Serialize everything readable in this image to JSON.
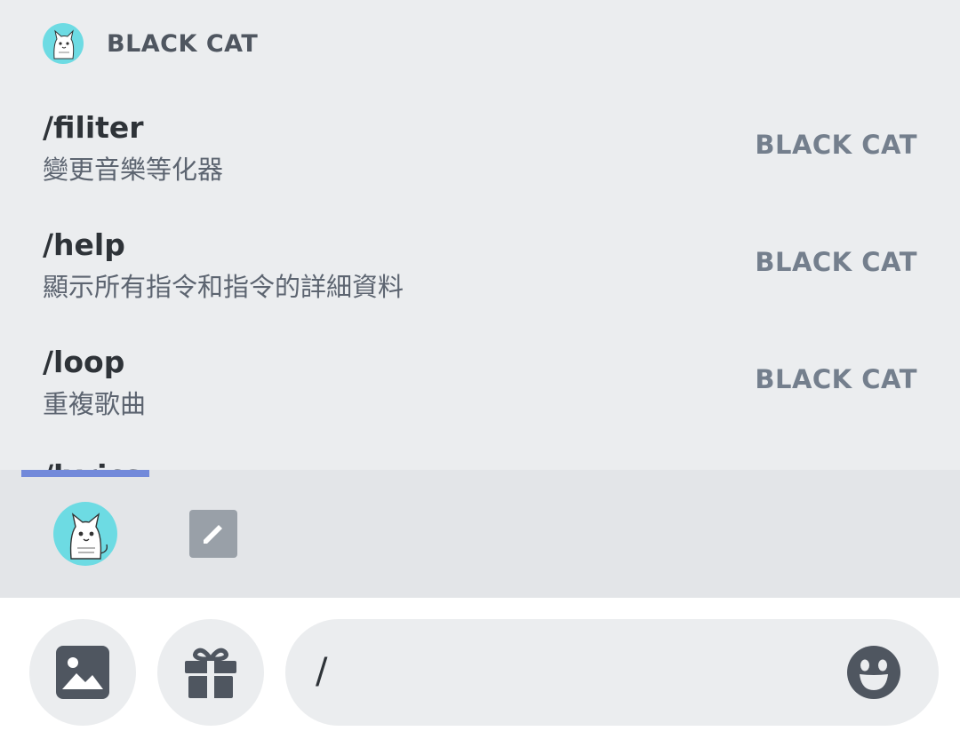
{
  "popup": {
    "bot_name": "BLACK CAT",
    "commands": [
      {
        "name": "/filiter",
        "description": "變更音樂等化器",
        "source": "BLACK CAT"
      },
      {
        "name": "/help",
        "description": "顯示所有指令和指令的詳細資料",
        "source": "BLACK CAT"
      },
      {
        "name": "/loop",
        "description": "重複歌曲",
        "source": "BLACK CAT"
      }
    ],
    "partial_command": "/lyrics"
  },
  "tabs": {
    "bot_tab_icon": "cat-avatar-icon",
    "builtin_tab_icon": "pencil-icon"
  },
  "composer": {
    "input_value": "/",
    "image_icon": "image-icon",
    "gift_icon": "gift-icon",
    "emoji_icon": "emoji-icon"
  },
  "colors": {
    "accent": "#7289da",
    "avatar_bg": "#6ddbe3",
    "popup_bg": "#ebedef"
  }
}
